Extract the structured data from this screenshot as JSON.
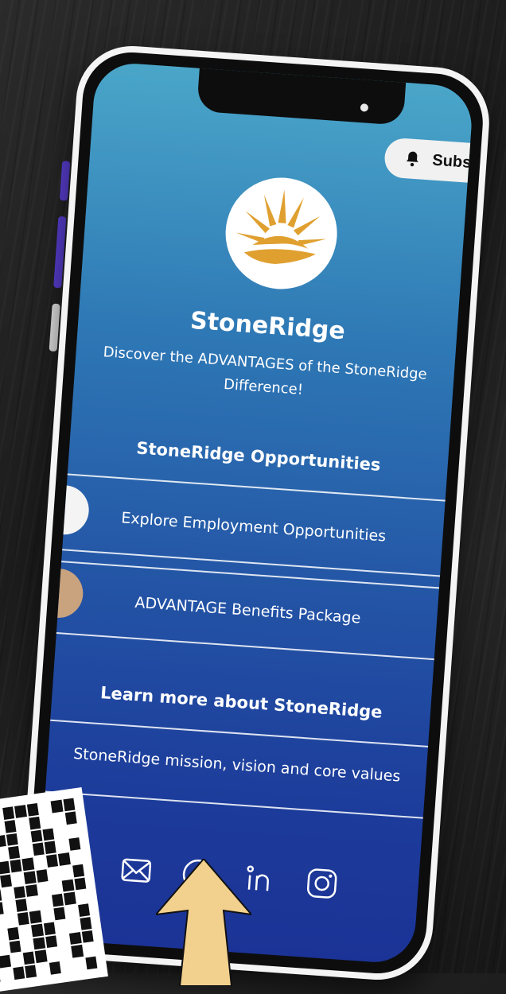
{
  "subscribe": {
    "label": "Subscr"
  },
  "profile": {
    "name": "StoneRidge",
    "tagline": "Discover the ADVANTAGES of the StoneRidge Difference!"
  },
  "sections": [
    {
      "heading": "StoneRidge Opportunities",
      "links": [
        {
          "label": "Explore Employment Opportunities"
        },
        {
          "label": "ADVANTAGE Benefits Package"
        }
      ]
    },
    {
      "heading": "Learn more about StoneRidge",
      "links": [
        {
          "label": "StoneRidge mission, vision and core values"
        }
      ]
    }
  ],
  "social": [
    "mail-icon",
    "facebook-icon",
    "linkedin-icon",
    "instagram-icon"
  ],
  "colors": {
    "screen_top": "#4aa6c9",
    "screen_bottom": "#1b3396",
    "logo_gold": "#e0a030",
    "arrow": "#f2d08e",
    "side_buttons": "#5a3fd4"
  }
}
